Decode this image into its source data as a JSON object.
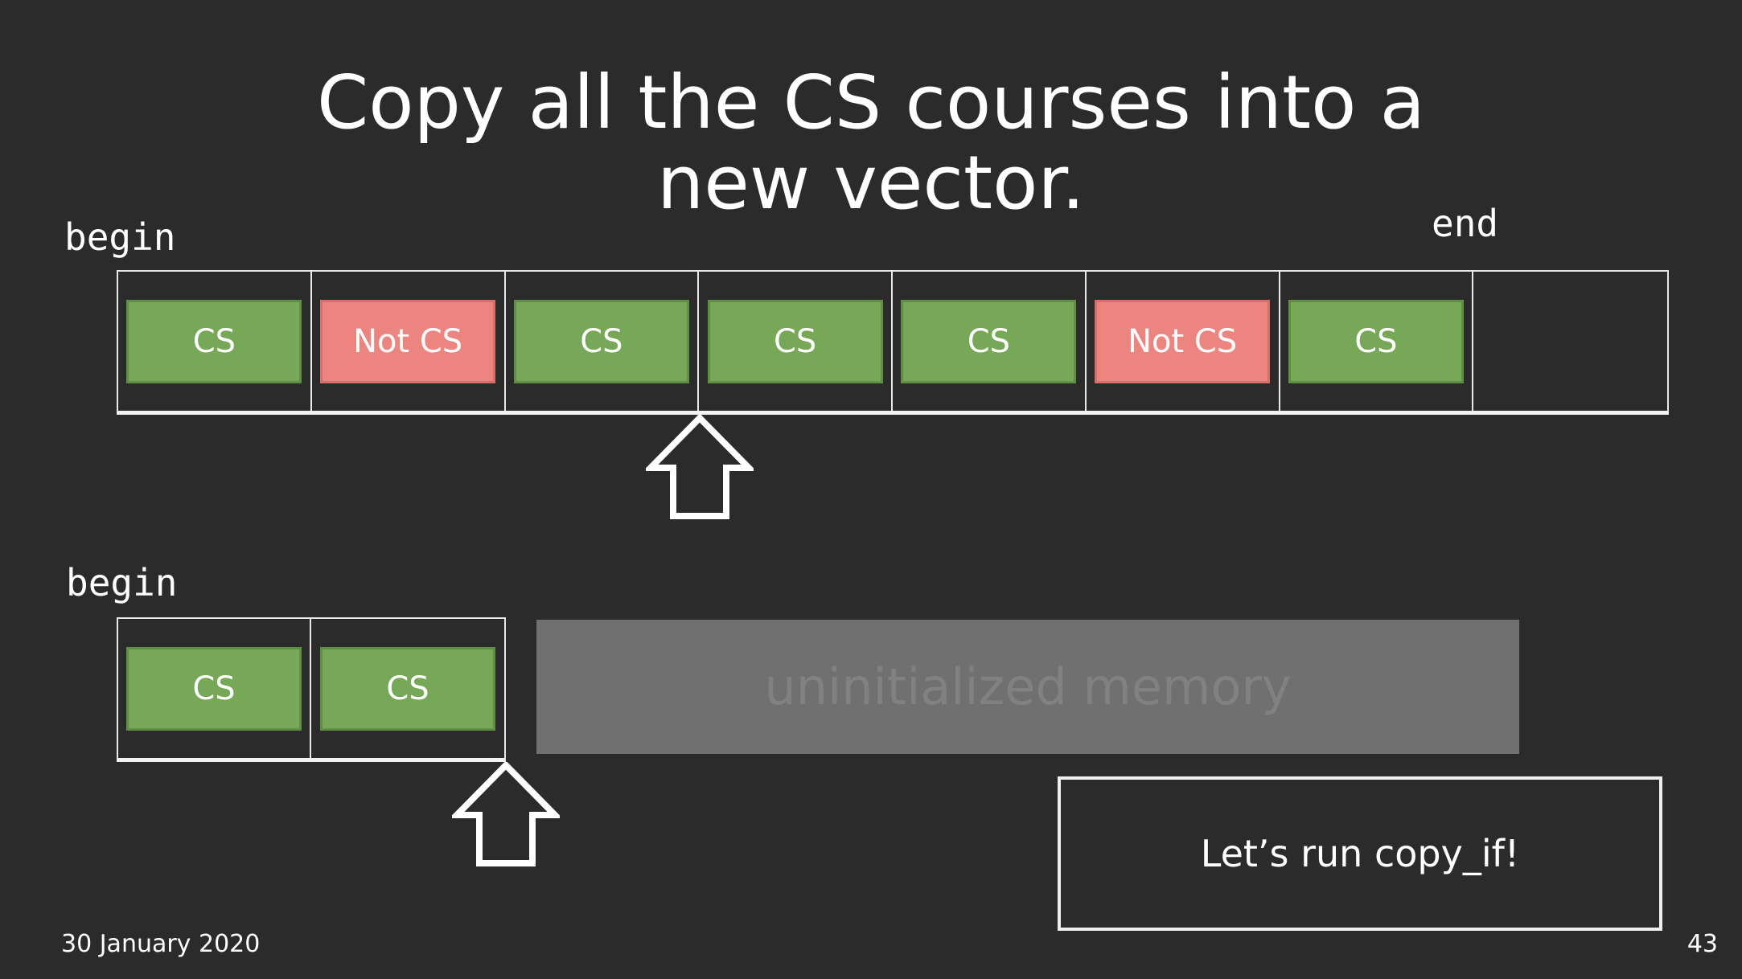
{
  "slide": {
    "title_line1": "Copy all the CS courses into a",
    "title_line2": "new vector.",
    "date": "30 January 2020",
    "page_number": "43"
  },
  "source": {
    "begin_label": "begin",
    "end_label": "end",
    "cells": [
      "CS",
      "Not CS",
      "CS",
      "CS",
      "CS",
      "Not CS",
      "CS",
      ""
    ]
  },
  "destination": {
    "begin_label": "begin",
    "cells": [
      "CS",
      "CS"
    ],
    "uninitialized_label": "uninitialized memory"
  },
  "callout": {
    "text": "Let’s run copy_if!"
  },
  "colors": {
    "background": "#2b2b2b",
    "cs": "#76a857",
    "not_cs": "#ec8580",
    "memory": "#707070"
  }
}
